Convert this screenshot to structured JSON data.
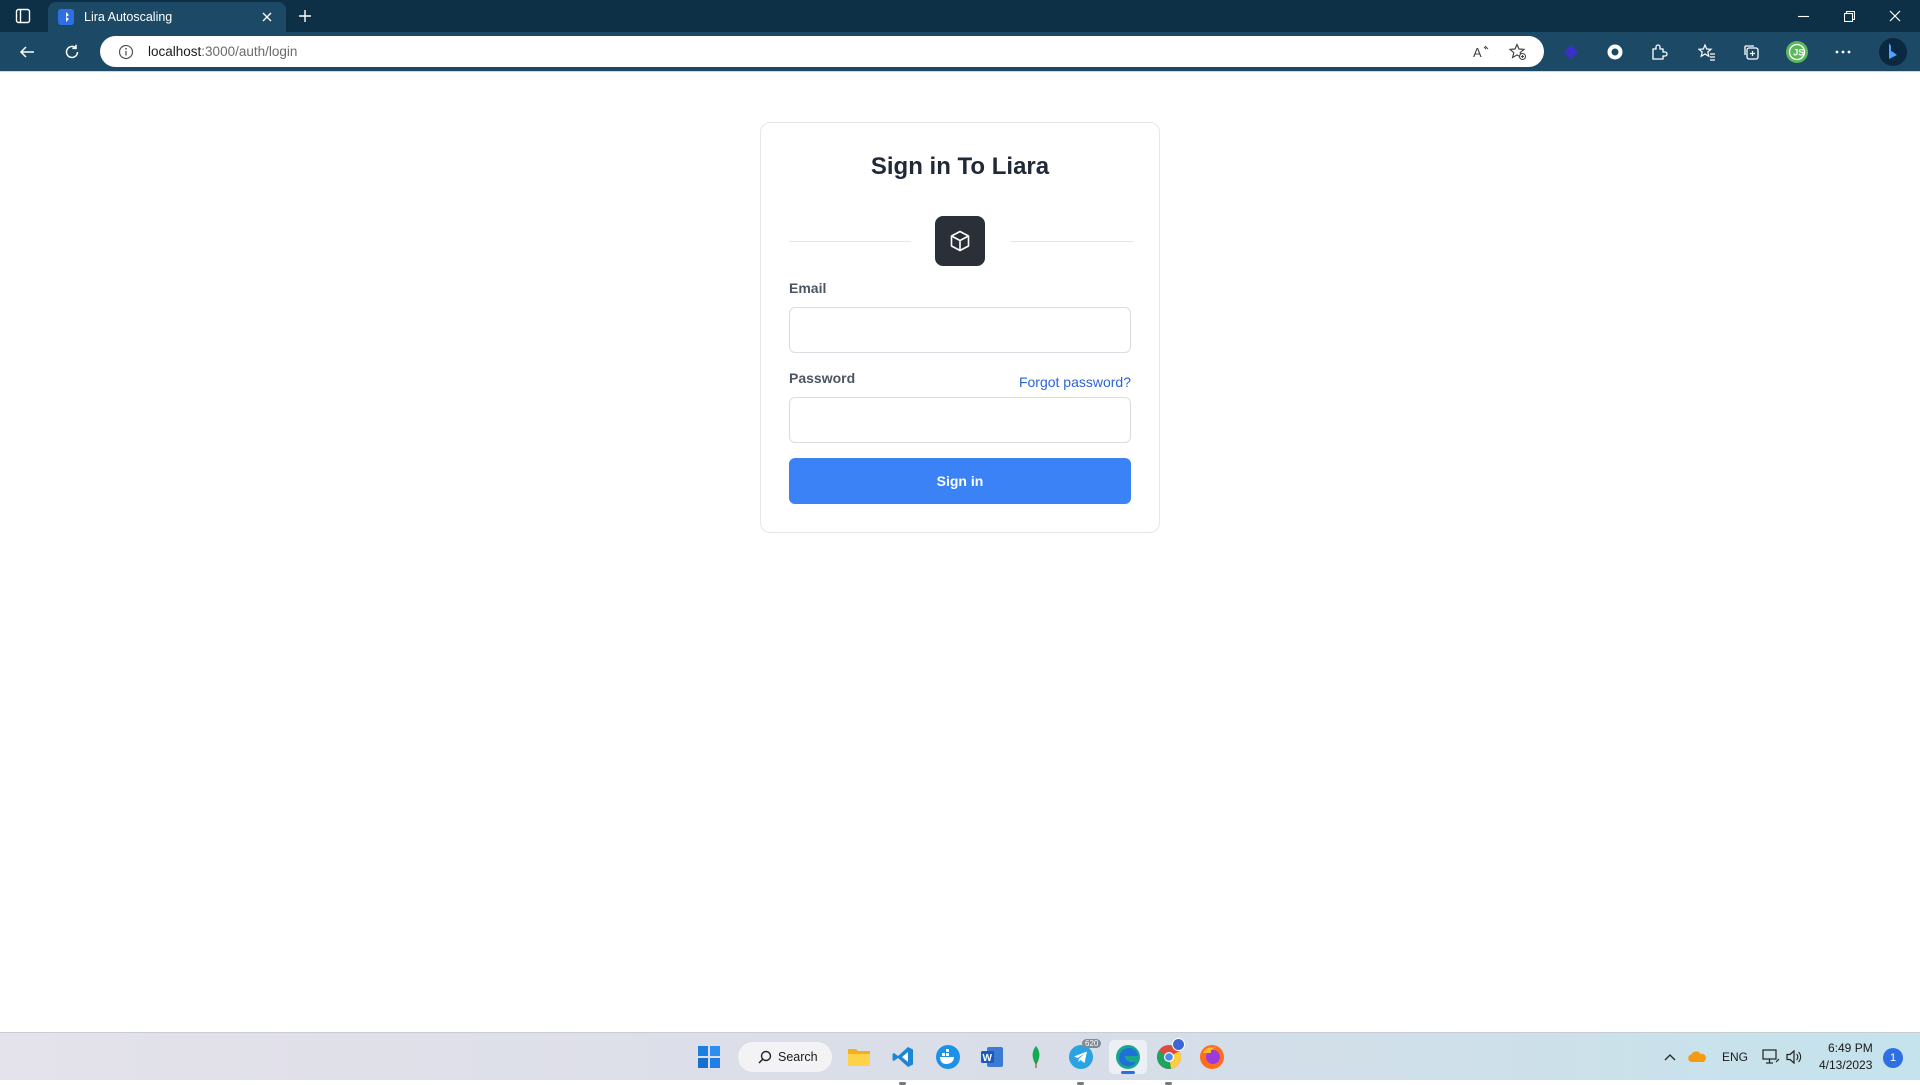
{
  "browser": {
    "tab_title": "Lira Autoscaling",
    "url_host": "localhost",
    "url_path": ":3000/auth/login"
  },
  "login": {
    "title": "Sign in To Liara",
    "email_label": "Email",
    "email_value": "",
    "password_label": "Password",
    "password_value": "",
    "forgot_password": "Forgot password?",
    "submit_label": "Sign in"
  },
  "taskbar": {
    "search_label": "Search",
    "language": "ENG",
    "time": "6:49 PM",
    "date": "4/13/2023",
    "notification_count": "1",
    "telegram_badge": "620"
  },
  "colors": {
    "primary_button": "#3b82f6",
    "link": "#2b63d9",
    "browser_frame": "#0d3047",
    "logo_box": "#2b2f38"
  }
}
